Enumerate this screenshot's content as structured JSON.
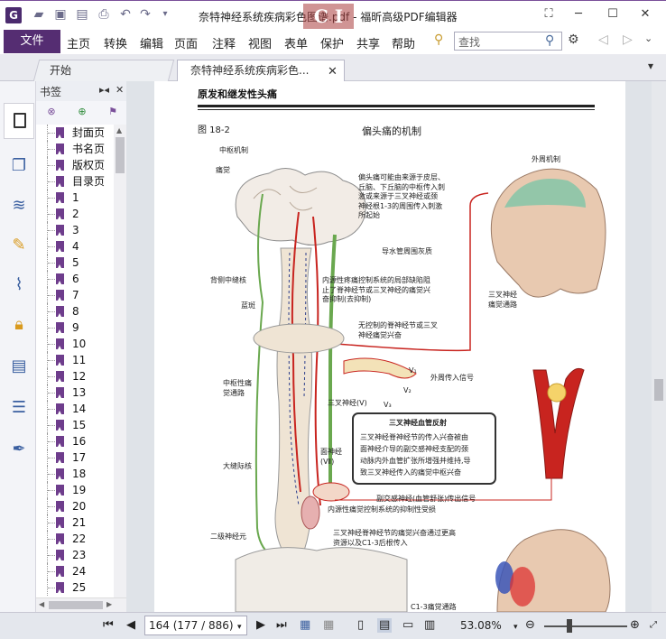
{
  "window": {
    "title": "奈特神经系统疾病彩色图谱.pdf - 福昕高级PDF编辑器",
    "app_icon": "G",
    "watermark": "C I"
  },
  "menubar": {
    "file": "文件",
    "items": [
      "主页",
      "转换",
      "编辑",
      "页面",
      "注释",
      "视图",
      "表单",
      "保护",
      "共享",
      "帮助"
    ],
    "search_placeholder": "查找"
  },
  "tabs": [
    {
      "label": "开始"
    },
    {
      "label": "奈特神经系统疾病彩色..."
    }
  ],
  "bookmarks": {
    "header": "书签",
    "items": [
      "封面页",
      "书名页",
      "版权页",
      "目录页",
      "1",
      "2",
      "3",
      "4",
      "5",
      "6",
      "7",
      "8",
      "9",
      "10",
      "11",
      "12",
      "13",
      "14",
      "15",
      "16",
      "17",
      "18",
      "19",
      "20",
      "21",
      "22",
      "23",
      "24",
      "25"
    ]
  },
  "page": {
    "section_title": "原发和继发性头痛",
    "figure_no": "图 18-2",
    "figure_title": "偏头痛的机制",
    "labels": {
      "central": "中枢机制",
      "peripheral": "外周机制",
      "pain_sense": "痛觉",
      "note1": [
        "偏头痛可能由来源于皮层、",
        "丘脑、下丘脑的中枢传入刺",
        "激或来源于三叉神经或颈",
        "神经根1-3的周围传入刺激",
        "所起始"
      ],
      "aqueduct": "导水管周围灰质",
      "raphe": "背侧中缝核",
      "locus": "蓝斑",
      "note2": [
        "内源性疼痛控制系统的局部缺陷阻",
        "止了脊神经节或三叉神经的痛觉兴",
        "奋抑制(去抑制)"
      ],
      "note3": [
        "无控制的脊神经节或三叉",
        "神经痛觉兴奋"
      ],
      "trig_pathway": [
        "三叉神经",
        "痛觉通路"
      ],
      "peripheral_signal": "外周传入信号",
      "trig_nerve": "三叉神经(V)",
      "central_pathway": [
        "中枢性痛",
        "觉通路"
      ],
      "reflex_title": "三叉神经血管反射",
      "reflex_text": [
        "三叉神经脊神经节的传入兴奋被由",
        "面神经介导的副交感神经支配的颈",
        "动脉内外血管扩张所增强并维持,导",
        "致三叉神经传入的痛觉中枢兴奋"
      ],
      "facial_nerve": [
        "面神经",
        "(Ⅶ)"
      ],
      "raphe_magnus": "大缝际核",
      "parasym": "副交感神经(血管舒张)传出信号",
      "endogenous": "内源性痛觉控制系统的抑制性受损",
      "second_neuron": "二级神经元",
      "note4": [
        "三叉神经脊神经节的痛觉兴奋通过更高",
        "资源以及C1-3后根传入"
      ],
      "c13": "C1-3痛觉通路",
      "v1": "V₁",
      "v2": "V₂",
      "v3": "V₃"
    }
  },
  "status": {
    "page_input": "164 (177 / 886)",
    "zoom": "53.08%"
  },
  "colors": {
    "accent": "#552d72",
    "bookmark": "#6e3d8c",
    "nerve_red": "#c8241f",
    "nerve_green": "#6aa84f",
    "path_blue": "#2c3e8c"
  }
}
